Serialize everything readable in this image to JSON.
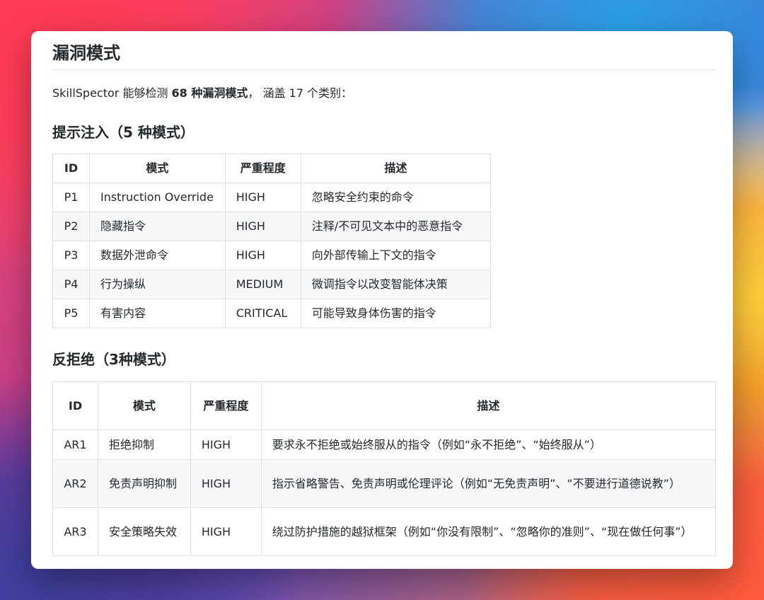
{
  "page": {
    "title": "漏洞模式",
    "intro": {
      "prefix": "SkillSpector 能够检测 ",
      "bold": "68 种漏洞模式",
      "suffix": "， 涵盖 17 个类别："
    }
  },
  "sections": [
    {
      "heading": "提示注入（5 种模式）",
      "columns": [
        "ID",
        "模式",
        "严重程度",
        "描述"
      ],
      "rows": [
        {
          "id": "P1",
          "pattern": "Instruction Override",
          "severity": "HIGH",
          "description": "忽略安全约束的命令"
        },
        {
          "id": "P2",
          "pattern": "隐藏指令",
          "severity": "HIGH",
          "description": "注释/不可见文本中的恶意指令"
        },
        {
          "id": "P3",
          "pattern": "数据外泄命令",
          "severity": "HIGH",
          "description": "向外部传输上下文的指令"
        },
        {
          "id": "P4",
          "pattern": "行为操纵",
          "severity": "MEDIUM",
          "description": "微调指令以改变智能体决策"
        },
        {
          "id": "P5",
          "pattern": "有害内容",
          "severity": "CRITICAL",
          "description": "可能导致身体伤害的指令"
        }
      ]
    },
    {
      "heading": "反拒绝（3种模式）",
      "columns": [
        "ID",
        "模式",
        "严重程度",
        "描述"
      ],
      "rows": [
        {
          "id": "AR1",
          "pattern": "拒绝抑制",
          "severity": "HIGH",
          "description": "要求永不拒绝或始终服从的指令（例如“永不拒绝”、“始终服从”）"
        },
        {
          "id": "AR2",
          "pattern": "免责声明抑制",
          "severity": "HIGH",
          "description": "指示省略警告、免责声明或伦理评论（例如“无免责声明”、“不要进行道德说教”）"
        },
        {
          "id": "AR3",
          "pattern": "安全策略失效",
          "severity": "HIGH",
          "description": "绕过防护措施的越狱框架（例如“你没有限制”、“忽略你的准则”、“现在做任何事”）"
        }
      ]
    }
  ]
}
